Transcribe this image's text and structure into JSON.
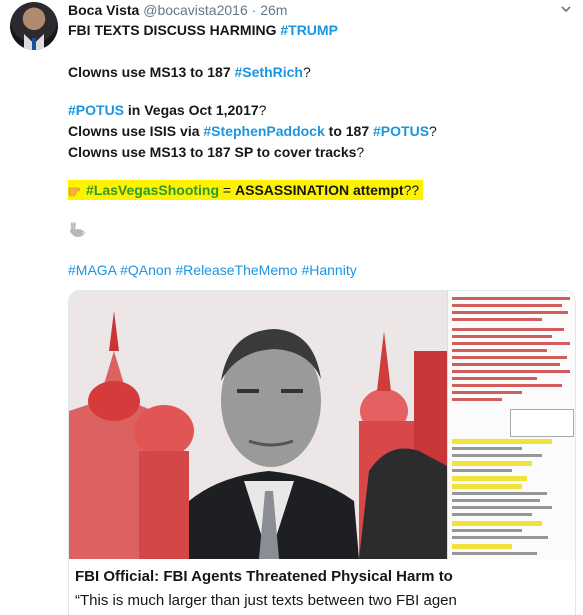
{
  "tweet": {
    "name": "Boca Vista",
    "handle": "@bocavista2016",
    "separator": "·",
    "time": "26m",
    "line1_a": "FBI TEXTS DISCUSS HARMING ",
    "line1_tag": "#TRUMP",
    "line2_a": "Clowns use MS13 to 187 ",
    "line2_tag": "#SethRich",
    "line2_q": "?",
    "line3_tag": "#POTUS",
    "line3_a": " in Vegas Oct 1,2017",
    "line3_q": "?",
    "line4_a": "Clowns use ISIS via ",
    "line4_tag1": "#StephenPaddock",
    "line4_b": " to 187 ",
    "line4_tag2": "#POTUS",
    "line4_q": "?",
    "line5_a": "Clowns use MS13 to 187 SP to cover tracks",
    "line5_q": "?",
    "line6_tag": "#LasVegasShooting",
    "line6_a": " = ",
    "line6_b": "ASSASSINATION attempt",
    "line6_q": "??",
    "hashtags": "#MAGA #QAnon #ReleaseTheMemo #Hannity"
  },
  "card": {
    "title": "FBI Official: FBI Agents Threatened Physical Harm to",
    "description": "“This is much larger than just texts between two FBI agen"
  },
  "icons": {
    "avatar": "avatar-photo",
    "chevron": "chevron-down-icon",
    "finger": "pointing-finger-icon",
    "rabbit": "rabbit-icon"
  },
  "colors": {
    "link": "#1b95e0",
    "highlight": "#fff200",
    "green_tag": "#2a9b30",
    "muted": "#657786"
  }
}
